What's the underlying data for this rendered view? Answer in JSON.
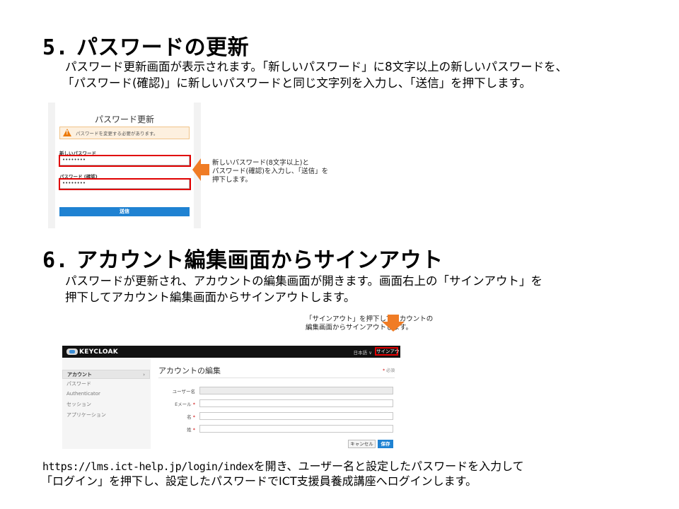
{
  "section5": {
    "number": "5.",
    "title": "パスワードの更新",
    "paragraph_line1": "パスワード更新画面が表示されます。「新しいパスワード」に8文字以上の新しいパスワードを、",
    "paragraph_line2": "「パスワード(確認)」に新しいパスワードと同じ文字列を入力し、「送信」を押下します。"
  },
  "password_screen": {
    "title": "パスワード更新",
    "alert_text": "パスワードを変更する必要があります。",
    "new_password_label": "新しいパスワード",
    "new_password_value": "••••••••",
    "confirm_label": "パスワード (確認)",
    "confirm_value": "••••••••",
    "submit_label": "送信"
  },
  "callout1": {
    "line1": "新しいパスワード(8文字以上)と",
    "line2": "パスワード(確認)を入力し、「送信」を",
    "line3": "押下します。"
  },
  "section6": {
    "number": "6.",
    "title": "アカウント編集画面からサインアウト",
    "paragraph_line1": "パスワードが更新され、アカウントの編集画面が開きます。画面右上の「サインアウト」を",
    "paragraph_line2": "押下してアカウント編集画面からサインアウトします。"
  },
  "callout2": {
    "line1": "「サインアウト」を押下してアカウントの",
    "line2": "編集画面からサインアウトします。"
  },
  "keycloak_screen": {
    "logo_text": "KEYCLOAK",
    "language": "日本語 ∨",
    "signout": "サインアウト",
    "nav": [
      "アカウント",
      "パスワード",
      "Authenticator",
      "セッション",
      "アプリケーション"
    ],
    "nav_chevron": "›",
    "page_title": "アカウントの編集",
    "required_note": "必須",
    "required_mark": "*",
    "fields": [
      "ユーザー名",
      "Eメール",
      "名",
      "姓"
    ],
    "cancel": "キャンセル",
    "save": "保存"
  },
  "footer": {
    "url": "https://lms.ict-help.jp/login/index",
    "line1_rest": "を開き、ユーザー名と設定したパスワードを入力して",
    "line2": "「ログイン」を押下し、設定したパスワードでICT支援員養成講座へログインします。"
  },
  "colors": {
    "highlight_red": "#e00000",
    "arrow_orange": "#f07c25",
    "button_blue": "#1f82d2"
  }
}
